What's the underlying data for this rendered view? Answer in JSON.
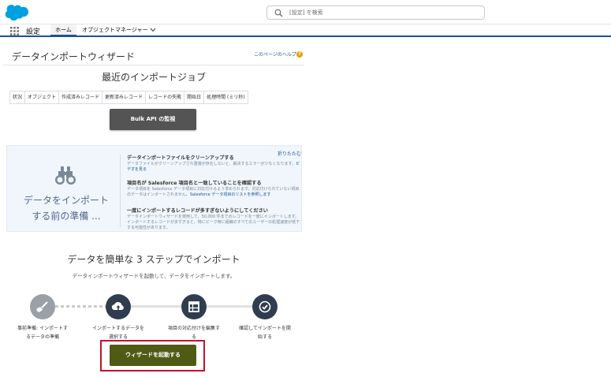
{
  "header": {
    "search_placeholder": "[設定] を検索"
  },
  "nav": {
    "app_name": "設定",
    "tabs": [
      {
        "label": "ホーム",
        "active": true
      },
      {
        "label": "オブジェクトマネージャー",
        "active": false
      }
    ]
  },
  "page": {
    "title": "データインポートウィザード",
    "help_link": "このページのヘルプ",
    "recent_jobs_title": "最近のインポートジョブ",
    "jobs_columns": [
      "状況",
      "オブジェクト",
      "作成済みレコード",
      "更新済みレコード",
      "レコードの失敗",
      "開始日",
      "処理時間 (ミリ秒)"
    ],
    "bulk_button": "Bulk API の監視"
  },
  "prep": {
    "title_line1": "データをインポート",
    "title_line2": "する前の準備 ...",
    "collapse": "折りたたむ",
    "tips": [
      {
        "heading": "データインポートファイルをクリーンアップする",
        "body": "データファイルがクリーンアップされ重複が存在しないと、解決するエラーが少なくなります。",
        "link": "ビデオを見る"
      },
      {
        "heading": "項目名が Salesforce 項目名と一致していることを確認する",
        "body": "データ項目を Salesforce データ項目に対応付けるよう求められます。対応付けられていない項目のデータはインポートされません。",
        "link": "Salesforce データ項目のリストを参照します"
      },
      {
        "heading": "一度にインポートするレコードが多すぎないようにしてください",
        "body": "データインポートウィザードを使用して、50,000 件までのレコードを一度にインポートします。インポートするレコードが多すぎると、特にピーク時に組織のすべてのユーザーの処理速度が低下する可能性があります。",
        "link": ""
      }
    ]
  },
  "steps": {
    "title": "データを簡単な 3 ステップでインポート",
    "subtitle": "データインポートウィザードを起動して、データをインポートします。",
    "items": [
      {
        "label_line1": "事前準備: インポートす",
        "label_line2": "るデータの準備",
        "icon": "broom-icon"
      },
      {
        "label_line1": "インポートするデータを",
        "label_line2": "選択する",
        "icon": "cloud-upload-icon"
      },
      {
        "label_line1": "項目の対応付けを編集す",
        "label_line2": "る",
        "icon": "table-icon"
      },
      {
        "label_line1": "確認してインポートを開",
        "label_line2": "始する",
        "icon": "check-icon"
      }
    ],
    "launch_button": "ウィザードを起動する"
  },
  "colors": {
    "brand_blue": "#00a1e0",
    "step_active": "#9aa0a6",
    "step_dark": "#2f3d4f",
    "launch_button": "#4f5a14",
    "highlight_red": "#c8102e"
  }
}
